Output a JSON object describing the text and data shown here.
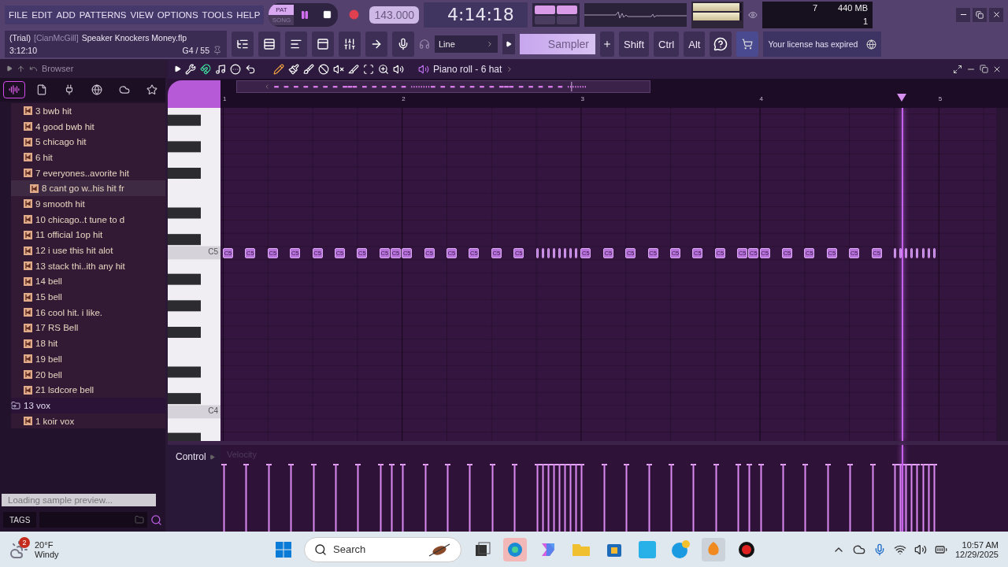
{
  "menu": [
    "FILE",
    "EDIT",
    "ADD",
    "PATTERNS",
    "VIEW",
    "OPTIONS",
    "TOOLS",
    "HELP"
  ],
  "transport": {
    "modes": [
      {
        "label": "PAT",
        "selected": true
      },
      {
        "label": "SONG",
        "selected": false
      }
    ],
    "tempo": "143.000",
    "time": "4:14:18"
  },
  "monitor": {
    "meters": [
      {
        "level": 0.95
      },
      {
        "level": 0.95
      }
    ],
    "cpu": "7",
    "memory": "440 MB",
    "polyphony": "1"
  },
  "project": {
    "trial": "(Trial)",
    "user": "[CianMcGill]",
    "file": "Speaker Knockers Money.flp",
    "elapsed": "3:12:10",
    "hint": "G4 / 55"
  },
  "snap": "Line",
  "channel": "Sampler",
  "modifiers": [
    "Shift",
    "Ctrl",
    "Alt"
  ],
  "news": "Your license has expired",
  "browser": {
    "title": "Browser",
    "tabs": [
      {
        "kind": "waveform",
        "selected": true
      },
      {
        "kind": "file",
        "selected": false
      },
      {
        "kind": "plugin",
        "selected": false
      },
      {
        "kind": "globe",
        "selected": false
      },
      {
        "kind": "cloud",
        "selected": false
      },
      {
        "kind": "star",
        "selected": false
      }
    ],
    "tree": [
      {
        "children": [
          {
            "kind": "sample",
            "label": "3 bwb hit",
            "selected": false
          },
          {
            "kind": "sample",
            "label": "4 good bwb hit",
            "selected": false
          },
          {
            "kind": "sample",
            "label": "5 chicago hit",
            "selected": false
          },
          {
            "kind": "sample",
            "label": "6 hit",
            "selected": false
          },
          {
            "kind": "sample",
            "label": "7 everyones..avorite hit",
            "selected": false
          },
          {
            "kind": "sample",
            "label": "8 cant go w..his hit fr",
            "selected": true
          },
          {
            "kind": "sample",
            "label": "9 smooth hit",
            "selected": false
          },
          {
            "kind": "sample",
            "label": "10 chicago..t tune to d",
            "selected": false
          },
          {
            "kind": "sample",
            "label": "11 official 1op hit",
            "selected": false
          },
          {
            "kind": "sample",
            "label": "12 i use this hit alot",
            "selected": false
          },
          {
            "kind": "sample",
            "label": "13 stack thi..ith any hit",
            "selected": false
          },
          {
            "kind": "sample",
            "label": "14 bell",
            "selected": false
          },
          {
            "kind": "sample",
            "label": "15 bell",
            "selected": false
          },
          {
            "kind": "sample",
            "label": "16 cool hit. i like.",
            "selected": false
          },
          {
            "kind": "sample",
            "label": "17 RS Bell",
            "selected": false
          },
          {
            "kind": "sample",
            "label": "18 hit",
            "selected": false
          },
          {
            "kind": "sample",
            "label": "19 bell",
            "selected": false
          },
          {
            "kind": "sample",
            "label": "20 bell",
            "selected": false
          },
          {
            "kind": "sample",
            "label": "21 lsdcore bell",
            "selected": false
          }
        ]
      },
      {
        "kind": "folder",
        "label": "13 vox",
        "selected": false,
        "children": [
          {
            "kind": "sample",
            "label": "1 koir vox",
            "selected": false
          }
        ]
      }
    ],
    "status": "Loading sample preview...",
    "tags": "TAGS"
  },
  "piano_roll": {
    "title": "Piano roll - 6 hat",
    "ruler": [
      "1",
      "2",
      "3",
      "4",
      "5"
    ],
    "keys": [
      "C5",
      "C4"
    ],
    "playhead": {
      "level": 0.878
    },
    "control": "Control",
    "control_param": "Velocity",
    "notes": [
      {
        "kind": "eighth",
        "label": "C5"
      },
      {
        "kind": "eighth",
        "label": "C5"
      },
      {
        "kind": "eighth",
        "label": "C5"
      },
      {
        "kind": "eighth",
        "label": "C5"
      },
      {
        "kind": "eighth",
        "label": "C5"
      },
      {
        "kind": "eighth",
        "label": "C5"
      },
      {
        "kind": "eighth",
        "label": "C5"
      },
      {
        "kind": "sixteenth",
        "label": "C5"
      },
      {
        "kind": "sixteenth",
        "label": "C5"
      },
      {
        "kind": "eighth",
        "label": "C5"
      },
      {
        "kind": "eighth",
        "label": "C5"
      },
      {
        "kind": "eighth",
        "label": "C5"
      },
      {
        "kind": "eighth",
        "label": "C5"
      },
      {
        "kind": "eighth",
        "label": "C5"
      },
      {
        "kind": "eighth",
        "label": "C5"
      },
      {
        "kind": "thirtysecond"
      },
      {
        "kind": "thirtysecond"
      },
      {
        "kind": "thirtysecond"
      },
      {
        "kind": "thirtysecond"
      },
      {
        "kind": "thirtysecond"
      },
      {
        "kind": "thirtysecond"
      },
      {
        "kind": "thirtysecond"
      },
      {
        "kind": "thirtysecond"
      },
      {
        "kind": "eighth",
        "label": "C5"
      },
      {
        "kind": "eighth",
        "label": "C5"
      },
      {
        "kind": "eighth",
        "label": "C5"
      },
      {
        "kind": "eighth",
        "label": "C5"
      },
      {
        "kind": "eighth",
        "label": "C5"
      },
      {
        "kind": "eighth",
        "label": "C5"
      },
      {
        "kind": "eighth",
        "label": "C5"
      },
      {
        "kind": "sixteenth",
        "label": "C5"
      },
      {
        "kind": "sixteenth",
        "label": "C5"
      },
      {
        "kind": "eighth",
        "label": "C5"
      },
      {
        "kind": "eighth",
        "label": "C5"
      },
      {
        "kind": "eighth",
        "label": "C5"
      },
      {
        "kind": "eighth",
        "label": "C5"
      },
      {
        "kind": "eighth",
        "label": "C5"
      },
      {
        "kind": "eighth",
        "label": "C5"
      },
      {
        "kind": "thirtysecond"
      },
      {
        "kind": "thirtysecond"
      },
      {
        "kind": "thirtysecond"
      },
      {
        "kind": "thirtysecond"
      },
      {
        "kind": "thirtysecond"
      },
      {
        "kind": "thirtysecond"
      },
      {
        "kind": "thirtysecond"
      },
      {
        "kind": "thirtysecond"
      }
    ]
  },
  "taskbar": {
    "badge": "2",
    "temperature": "20°F",
    "condition": "Windy",
    "search": "Search",
    "time": "10:57 AM",
    "date": "12/29/2025"
  }
}
